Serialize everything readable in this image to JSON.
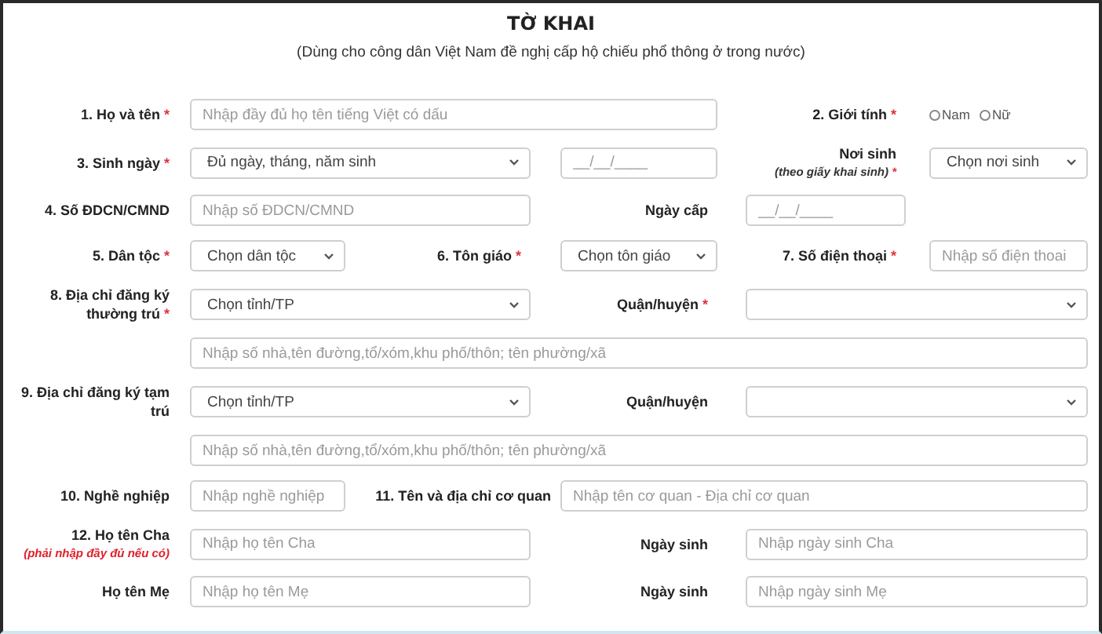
{
  "title": "TỜ KHAI",
  "subtitle": "(Dùng cho công dân Việt Nam đề nghị cấp hộ chiếu phổ thông ở trong nước)",
  "rows": [
    {
      "items": [
        {
          "kind": "label",
          "text": "1. Họ và tên",
          "mark": "*"
        },
        {
          "kind": "input",
          "placeholder": "Nhập đầy đủ họ tên tiếng Việt có dấu"
        },
        {
          "kind": "label",
          "text": "2. Giới tính",
          "mark": "*"
        },
        {
          "kind": "radio",
          "options": [
            {
              "label": "Nam",
              "selected": false
            },
            {
              "label": "Nữ",
              "selected": false
            }
          ]
        }
      ]
    },
    {
      "items": [
        {
          "kind": "label",
          "text": "3. Sinh ngày",
          "mark": "*"
        },
        {
          "kind": "select",
          "value": "Đủ ngày, tháng, năm sinh"
        },
        {
          "kind": "input",
          "placeholder": "__/__/____"
        },
        {
          "kind": "label",
          "text": "Nơi sinh",
          "note": "(theo giấy khai sinh)",
          "warning": false,
          "mark": "*"
        },
        {
          "kind": "select",
          "value": "Chọn nơi sinh"
        }
      ]
    },
    {
      "items": [
        {
          "kind": "label",
          "text": "4. Số ĐDCN/CMND"
        },
        {
          "kind": "input",
          "placeholder": "Nhập số ĐDCN/CMND"
        },
        {
          "kind": "label",
          "text": "Ngày cấp"
        },
        {
          "kind": "input",
          "placeholder": "__/__/____"
        }
      ]
    },
    {
      "items": [
        {
          "kind": "label",
          "text": "5. Dân tộc",
          "mark": "*"
        },
        {
          "kind": "select",
          "value": "Chọn dân tộc"
        },
        {
          "kind": "label",
          "text": "6. Tôn giáo",
          "mark": "*"
        },
        {
          "kind": "select",
          "value": "Chọn tôn giáo"
        },
        {
          "kind": "label",
          "text": "7. Số điện thoại",
          "mark": "*"
        },
        {
          "kind": "input",
          "placeholder": "Nhập số điện thoai"
        }
      ]
    },
    {
      "items": [
        {
          "kind": "label",
          "text": "8. Địa chỉ đăng ký thường trú",
          "mark": "*"
        },
        {
          "kind": "select",
          "value": "Chọn tỉnh/TP"
        },
        {
          "kind": "label",
          "text": "Quận/huyện",
          "mark": "*"
        },
        {
          "kind": "select"
        }
      ]
    },
    {
      "items": [
        {
          "kind": "input",
          "placeholder": "Nhập số nhà,tên đường,tổ/xóm,khu phố/thôn; tên phường/xã"
        }
      ]
    },
    {
      "items": [
        {
          "kind": "label",
          "text": "9. Địa chỉ đăng ký tạm trú"
        },
        {
          "kind": "select",
          "value": "Chọn tỉnh/TP"
        },
        {
          "kind": "label",
          "text": "Quận/huyện"
        },
        {
          "kind": "select"
        }
      ]
    },
    {
      "items": [
        {
          "kind": "input",
          "placeholder": "Nhập số nhà,tên đường,tổ/xóm,khu phố/thôn; tên phường/xã"
        }
      ]
    },
    {
      "items": [
        {
          "kind": "label",
          "text": "10. Nghề nghiệp"
        },
        {
          "kind": "input",
          "placeholder": "Nhập nghề nghiệp"
        },
        {
          "kind": "label",
          "text": "11. Tên và địa chỉ cơ quan"
        },
        {
          "kind": "input",
          "placeholder": "Nhập tên cơ quan - Địa chỉ cơ quan"
        }
      ]
    },
    {
      "items": [
        {
          "kind": "label",
          "text": "12. Họ tên Cha",
          "note": "(phải nhập đầy đủ nếu có)",
          "warning": true
        },
        {
          "kind": "input",
          "placeholder": "Nhập họ tên Cha"
        },
        {
          "kind": "label",
          "text": "Ngày sinh"
        },
        {
          "kind": "input",
          "placeholder": "Nhập ngày sinh Cha"
        }
      ]
    },
    {
      "items": [
        {
          "kind": "label",
          "text": "Họ tên Mẹ"
        },
        {
          "kind": "input",
          "placeholder": "Nhập họ tên Mẹ"
        },
        {
          "kind": "label",
          "text": "Ngày sinh"
        },
        {
          "kind": "input",
          "placeholder": "Nhập ngày sinh Mẹ"
        }
      ]
    }
  ]
}
